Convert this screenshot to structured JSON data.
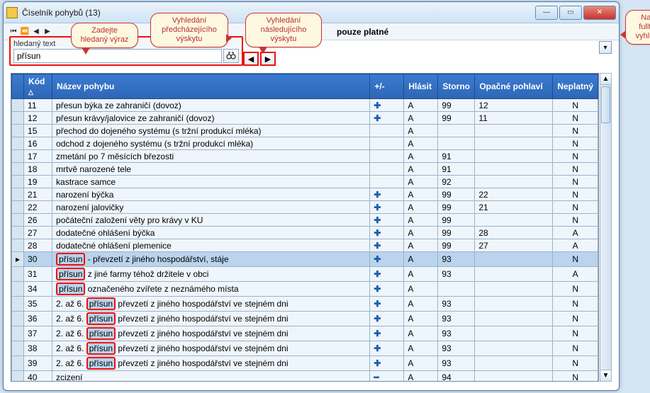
{
  "window": {
    "title": "Číselník pohybů (13)"
  },
  "toolbar": {
    "only_valid": "pouze platné"
  },
  "search": {
    "label": "hledaný text",
    "value": "přísun",
    "binoc_icon": "binoculars-icon"
  },
  "callouts": {
    "enter_term": "Zadejte hledaný výraz",
    "prev": "Vyhledání předcházejícího výskytu",
    "next": "Vyhledání následujícího výskytu",
    "fulltext": "Nastavte fulltextové vyhledávání"
  },
  "grid": {
    "columns": {
      "kod": "Kód",
      "nazev": "Název pohybu",
      "pm": "+/-",
      "hlasit": "Hlásit",
      "storno": "Storno",
      "opac": "Opačné pohlaví",
      "neplat": "Neplatný"
    },
    "rows": [
      {
        "kod": "11",
        "nazev_pre": "",
        "hl": "",
        "nazev_post": "přesun býka ze zahraničí (dovoz)",
        "pm": "+",
        "hlasit": "A",
        "storno": "99",
        "opac": "12",
        "neplat": "N",
        "sel": false
      },
      {
        "kod": "12",
        "nazev_pre": "",
        "hl": "",
        "nazev_post": "přesun krávy/jalovice ze zahraničí (dovoz)",
        "pm": "+",
        "hlasit": "A",
        "storno": "99",
        "opac": "11",
        "neplat": "N",
        "sel": false
      },
      {
        "kod": "15",
        "nazev_pre": "",
        "hl": "",
        "nazev_post": "přechod do dojeného systému (s tržní produkcí mléka)",
        "pm": "",
        "hlasit": "A",
        "storno": "",
        "opac": "",
        "neplat": "N",
        "sel": false
      },
      {
        "kod": "16",
        "nazev_pre": "",
        "hl": "",
        "nazev_post": "odchod z dojeného systému (s tržní produkcí mléka)",
        "pm": "",
        "hlasit": "A",
        "storno": "",
        "opac": "",
        "neplat": "N",
        "sel": false
      },
      {
        "kod": "17",
        "nazev_pre": "",
        "hl": "",
        "nazev_post": "zmetání po 7 měsících březosti",
        "pm": "",
        "hlasit": "A",
        "storno": "91",
        "opac": "",
        "neplat": "N",
        "sel": false
      },
      {
        "kod": "18",
        "nazev_pre": "",
        "hl": "",
        "nazev_post": "mrtvě narozené tele",
        "pm": "",
        "hlasit": "A",
        "storno": "91",
        "opac": "",
        "neplat": "N",
        "sel": false
      },
      {
        "kod": "19",
        "nazev_pre": "",
        "hl": "",
        "nazev_post": "kastrace samce",
        "pm": "",
        "hlasit": "A",
        "storno": "92",
        "opac": "",
        "neplat": "N",
        "sel": false
      },
      {
        "kod": "21",
        "nazev_pre": "",
        "hl": "",
        "nazev_post": "narození býčka",
        "pm": "+",
        "hlasit": "A",
        "storno": "99",
        "opac": "22",
        "neplat": "N",
        "sel": false
      },
      {
        "kod": "22",
        "nazev_pre": "",
        "hl": "",
        "nazev_post": "narození jalovičky",
        "pm": "+",
        "hlasit": "A",
        "storno": "99",
        "opac": "21",
        "neplat": "N",
        "sel": false
      },
      {
        "kod": "26",
        "nazev_pre": "",
        "hl": "",
        "nazev_post": "počáteční založení věty pro krávy v KU",
        "pm": "+",
        "hlasit": "A",
        "storno": "99",
        "opac": "",
        "neplat": "N",
        "sel": false
      },
      {
        "kod": "27",
        "nazev_pre": "",
        "hl": "",
        "nazev_post": "dodatečné ohlášení býčka",
        "pm": "+",
        "hlasit": "A",
        "storno": "99",
        "opac": "28",
        "neplat": "A",
        "sel": false
      },
      {
        "kod": "28",
        "nazev_pre": "",
        "hl": "",
        "nazev_post": "dodatečné ohlášení plemenice",
        "pm": "+",
        "hlasit": "A",
        "storno": "99",
        "opac": "27",
        "neplat": "A",
        "sel": false
      },
      {
        "kod": "30",
        "nazev_pre": "",
        "hl": "přísun",
        "nazev_post": " - převzetí z jiného hospodářství, stáje",
        "pm": "+",
        "hlasit": "A",
        "storno": "93",
        "opac": "",
        "neplat": "N",
        "sel": true
      },
      {
        "kod": "31",
        "nazev_pre": "",
        "hl": "přísun",
        "nazev_post": " z jiné farmy téhož držitele v obci",
        "pm": "+",
        "hlasit": "A",
        "storno": "93",
        "opac": "",
        "neplat": "A",
        "sel": false
      },
      {
        "kod": "34",
        "nazev_pre": "",
        "hl": "přísun",
        "nazev_post": " označeného zvířete z neznámého místa",
        "pm": "+",
        "hlasit": "A",
        "storno": "",
        "opac": "",
        "neplat": "N",
        "sel": false
      },
      {
        "kod": "35",
        "nazev_pre": "2. až 6. ",
        "hl": "přísun",
        "nazev_post": " převzetí z jiného hospodářství ve stejném dni",
        "pm": "+",
        "hlasit": "A",
        "storno": "93",
        "opac": "",
        "neplat": "N",
        "sel": false
      },
      {
        "kod": "36",
        "nazev_pre": "2. až 6. ",
        "hl": "přísun",
        "nazev_post": " převzetí z jiného hospodářství ve stejném dni",
        "pm": "+",
        "hlasit": "A",
        "storno": "93",
        "opac": "",
        "neplat": "N",
        "sel": false
      },
      {
        "kod": "37",
        "nazev_pre": "2. až 6. ",
        "hl": "přísun",
        "nazev_post": " převzetí z jiného hospodářství ve stejném dni",
        "pm": "+",
        "hlasit": "A",
        "storno": "93",
        "opac": "",
        "neplat": "N",
        "sel": false
      },
      {
        "kod": "38",
        "nazev_pre": "2. až 6. ",
        "hl": "přísun",
        "nazev_post": " převzetí z jiného hospodářství ve stejném dni",
        "pm": "+",
        "hlasit": "A",
        "storno": "93",
        "opac": "",
        "neplat": "N",
        "sel": false
      },
      {
        "kod": "39",
        "nazev_pre": "2. až 6. ",
        "hl": "přísun",
        "nazev_post": " převzetí z jiného hospodářství ve stejném dni",
        "pm": "+",
        "hlasit": "A",
        "storno": "93",
        "opac": "",
        "neplat": "N",
        "sel": false
      },
      {
        "kod": "40",
        "nazev_pre": "",
        "hl": "",
        "nazev_post": "zcizení",
        "pm": "−",
        "hlasit": "A",
        "storno": "94",
        "opac": "",
        "neplat": "N",
        "sel": false
      }
    ]
  }
}
